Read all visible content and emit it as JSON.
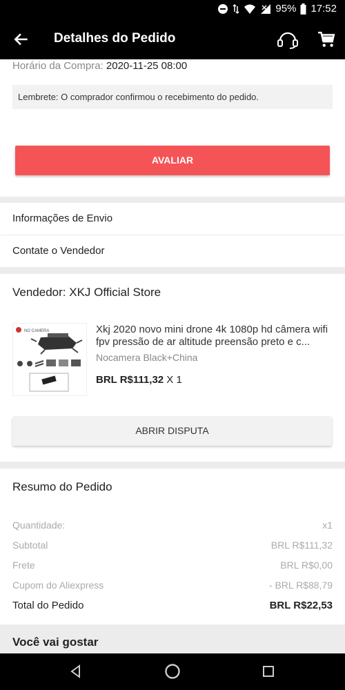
{
  "status_bar": {
    "battery": "95%",
    "time": "17:52"
  },
  "header": {
    "title": "Detalhes do Pedido"
  },
  "order": {
    "purchase_time_label": "Horário da Compra:",
    "purchase_time_value": "2020-11-25 08:00",
    "reminder": "Lembrete: O comprador confirmou o recebimento do pedido.",
    "rate_button": "AVALIAR"
  },
  "links": {
    "shipping_info": "Informações de Envio",
    "contact_seller": "Contate o Vendedor"
  },
  "seller": {
    "label": "Vendedor: XKJ Official Store"
  },
  "product": {
    "image_caption": "NO CAMERA",
    "title": "Xkj 2020 novo mini drone 4k 1080p hd câmera wifi fpv pressão de ar altitude preensão preto e c...",
    "variant": "Nocamera Black+China",
    "price": "BRL R$111,32",
    "quantity": "X 1",
    "dispute_button": "ABRIR DISPUTA"
  },
  "summary": {
    "title": "Resumo do Pedido",
    "rows": [
      {
        "label": "Quantidade:",
        "value": "x1"
      },
      {
        "label": "Subtotal",
        "value": "BRL R$111,32"
      },
      {
        "label": "Frete",
        "value": "BRL R$0,00"
      },
      {
        "label": "Cupom do Aliexpress",
        "value": "- BRL R$88,79"
      }
    ],
    "total_label": "Total do Pedido",
    "total_value": "BRL R$22,53"
  },
  "recommend": {
    "title": "Você vai gostar"
  },
  "colors": {
    "accent": "#f55456",
    "bar": "#000000"
  }
}
